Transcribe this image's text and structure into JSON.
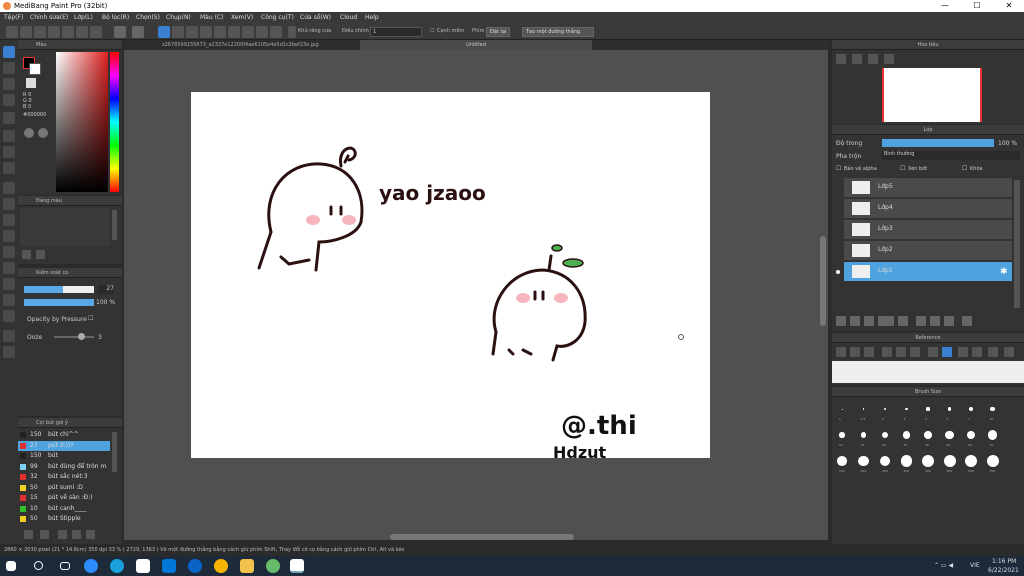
{
  "window": {
    "title": "MediBang Paint Pro (32bit)",
    "minimize": "—",
    "maximize": "☐",
    "close": "✕"
  },
  "menu": [
    "Tệp(F)",
    "Chỉnh sửa(E)",
    "Lớp(L)",
    "Bộ lọc(R)",
    "Chọn(S)",
    "Chụp(N)",
    "Màu (C)",
    "Xem(V)",
    "Công cụ(T)",
    "Cửa sổ(W)",
    "Cloud",
    "Help"
  ],
  "toolbar": {
    "anti_alias": "Khử răng cưa",
    "adjust": "Điều chỉnh",
    "adjust_value": "1",
    "edge": "Cạnh mềm",
    "key": "Phím",
    "cancel": "Đặt lại",
    "straight_line": "Tạo một đường thẳng"
  },
  "tabs": {
    "file": "z2678599155673_a2337e12200f4ae6105e4e5d1c2bef23e.jpg",
    "active": "Untitled"
  },
  "color_panel": {
    "title": "Màu",
    "r": "R 0",
    "g": "G 0",
    "b": "B 0",
    "hex": "#000000",
    "fg": "#000000",
    "bg": "#ffffff"
  },
  "color_history": {
    "title": "Đảng màu"
  },
  "brush_control": {
    "title": "Kiểm soát cọ",
    "size": "27",
    "opacity": "100 %",
    "opacity_pressure": "Opacity by Pressure",
    "ooze_label": "Ooze",
    "ooze_value": "3",
    "size_level": 0.55,
    "opacity_level": 1.0,
    "ooze_level": 0.6
  },
  "brush_list": {
    "title": "Cọ/ bút gợi ý",
    "items": [
      {
        "size": "150",
        "name": "bút chì^^",
        "color": "#222222"
      },
      {
        "size": "27",
        "name": "pút ớ:))?",
        "color": "#e03030"
      },
      {
        "size": "150",
        "name": "bút",
        "color": "#222222"
      },
      {
        "size": "99",
        "name": "bút dùng để tròn m",
        "color": "#7ad0f0"
      },
      {
        "size": "32",
        "name": "bút sắc nét:3",
        "color": "#e03030"
      },
      {
        "size": "50",
        "name": "pút sumi :D",
        "color": "#f0d020"
      },
      {
        "size": "15",
        "name": "pút vẽ sàn :Đ:)",
        "color": "#e03030"
      },
      {
        "size": "10",
        "name": "bút canh____",
        "color": "#30c030"
      },
      {
        "size": "50",
        "name": "bút Stipple",
        "color": "#f0d020"
      }
    ]
  },
  "canvas_text": {
    "handwriting1": "yao jzaoo",
    "handwriting2": "@.thi",
    "handwriting3": "Hdzut"
  },
  "navigator": {
    "title": "Hoa tiêu"
  },
  "layer_panel": {
    "title": "Lớp",
    "opacity_label": "Độ trong",
    "opacity_value": "100 %",
    "opacity_level": 1.0,
    "blend_label": "Pha trộn",
    "blend_value": "Bình thường",
    "protect_alpha": "Bảo vệ alpha",
    "clip": "Xén bớt",
    "lock": "Khóa",
    "layers": [
      "Lớp5",
      "Lớp4",
      "Lớp3",
      "Lớp2",
      "Lớp1"
    ],
    "active": "Lớp1"
  },
  "reference": {
    "title": "Reference"
  },
  "brush_size": {
    "title": "Brush Size",
    "sizes": [
      "1",
      "1.5",
      "2",
      "3",
      "4",
      "5",
      "7",
      "10",
      "12",
      "15",
      "20",
      "25",
      "30",
      "40",
      "50",
      "70",
      "100",
      "150",
      "200",
      "250",
      "300",
      "400",
      "500",
      "700",
      "1000"
    ]
  },
  "status": "2860 × 2030 pixel  (21 * 14.8cm)  350 dpi  33 %  ( 2729, 1363 )  Vẽ một đường thẳng bằng cách giữ phím Shift, Thay đổi cỡ cọ bằng cách giữ phím Ctrl, Alt và kéo",
  "taskbar": {
    "time": "1:16 PM",
    "date": "6/22/2021",
    "lang": "VIE"
  }
}
